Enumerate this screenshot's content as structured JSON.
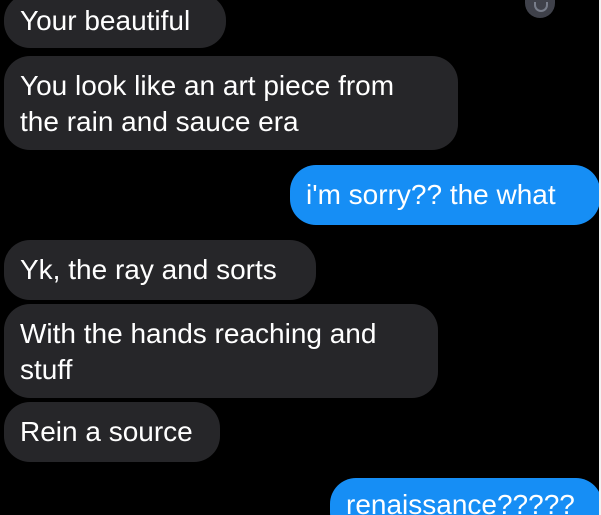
{
  "messages": [
    {
      "direction": "incoming",
      "lines": [
        "Your beautiful"
      ]
    },
    {
      "direction": "incoming",
      "lines": [
        "You look like an art piece from",
        "the rain and sauce era"
      ]
    },
    {
      "direction": "outgoing",
      "lines": [
        "i'm sorry?? the what"
      ]
    },
    {
      "direction": "incoming",
      "lines": [
        "Yk, the ray and sorts"
      ]
    },
    {
      "direction": "incoming",
      "lines": [
        "With the hands reaching and",
        "stuff"
      ]
    },
    {
      "direction": "incoming",
      "lines": [
        "Rein a source"
      ]
    },
    {
      "direction": "outgoing",
      "lines": [
        "renaissance?????"
      ]
    }
  ],
  "colors": {
    "background": "#000000",
    "incoming_bubble": "#262629",
    "outgoing_bubble": "#168ef5",
    "text": "#ffffff"
  },
  "icons": {
    "top_right": "watermark-icon"
  }
}
